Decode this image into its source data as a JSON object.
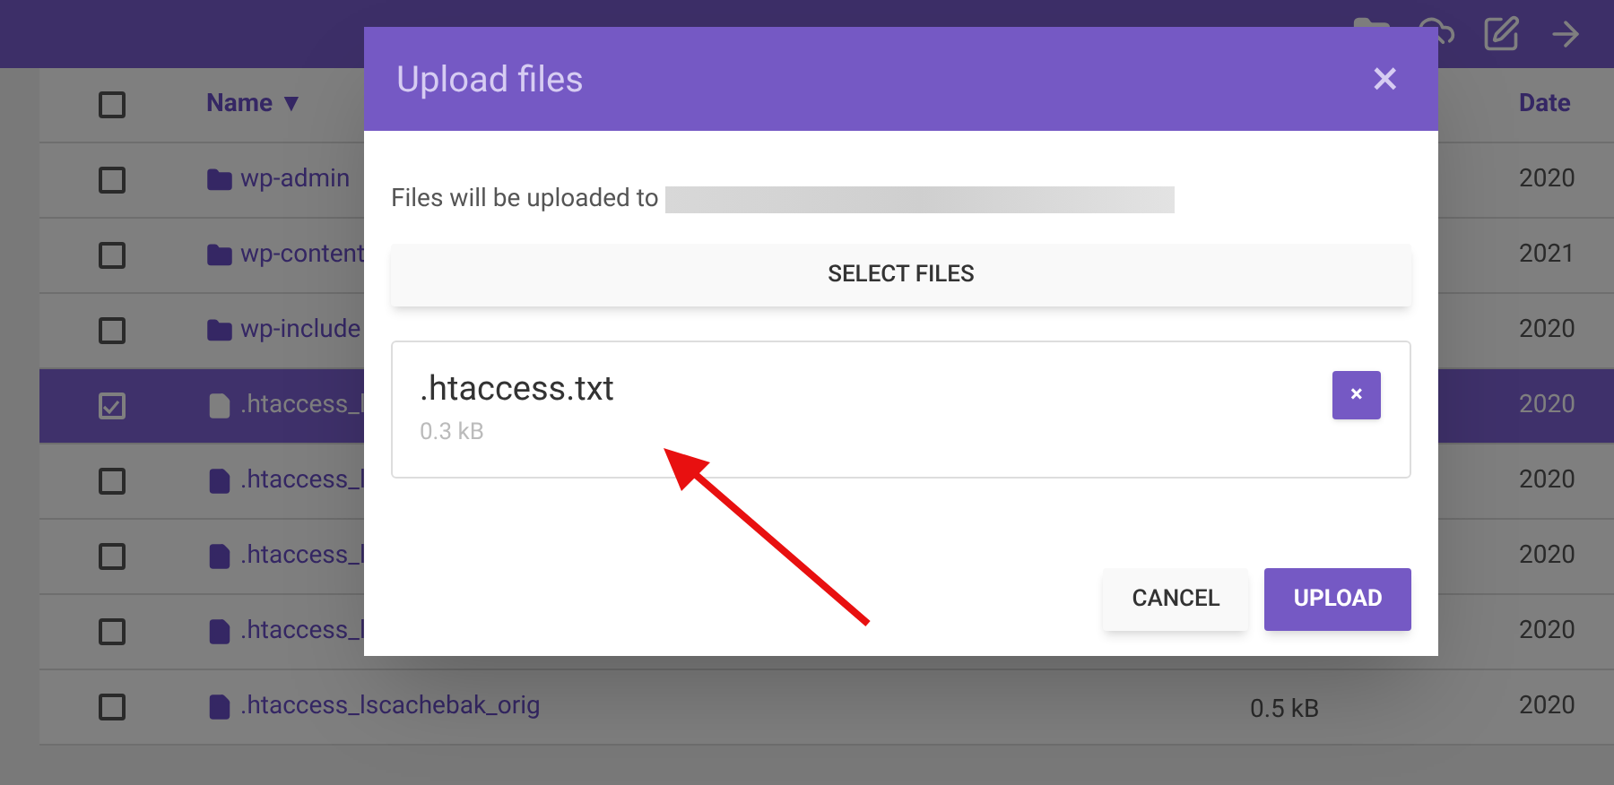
{
  "table": {
    "select_all": {
      "checked": false
    },
    "columns": [
      {
        "label": "Name ▼"
      },
      {
        "label": "Date"
      }
    ],
    "rows": [
      {
        "kind": "folder",
        "name": "wp-admin",
        "size": "",
        "date": "2020",
        "selected": false,
        "checked": false
      },
      {
        "kind": "folder",
        "name": "wp-content",
        "size": "",
        "date": "2021",
        "selected": false,
        "checked": false
      },
      {
        "kind": "folder",
        "name": "wp-include",
        "size": "",
        "date": "2020",
        "selected": false,
        "checked": false
      },
      {
        "kind": "file",
        "name": ".htaccess_l",
        "size": "",
        "date": "2020",
        "selected": true,
        "checked": true
      },
      {
        "kind": "file",
        "name": ".htaccess_l",
        "size": "",
        "date": "2020",
        "selected": false,
        "checked": false
      },
      {
        "kind": "file",
        "name": ".htaccess_l",
        "size": "",
        "date": "2020",
        "selected": false,
        "checked": false
      },
      {
        "kind": "file",
        "name": ".htaccess_l",
        "size": "",
        "date": "2020",
        "selected": false,
        "checked": false
      },
      {
        "kind": "file",
        "name": ".htaccess_lscachebak_orig",
        "size": "0.5 kB",
        "date": "2020",
        "selected": false,
        "checked": false
      }
    ]
  },
  "dialog": {
    "title": "Upload files",
    "close": "×",
    "destination_label": "Files will be uploaded to",
    "select_button": "SELECT FILES",
    "files": [
      {
        "name": ".htaccess.txt",
        "size": "0.3 kB",
        "remove": "×"
      }
    ],
    "cancel_button": "CANCEL",
    "upload_button": "UPLOAD"
  }
}
